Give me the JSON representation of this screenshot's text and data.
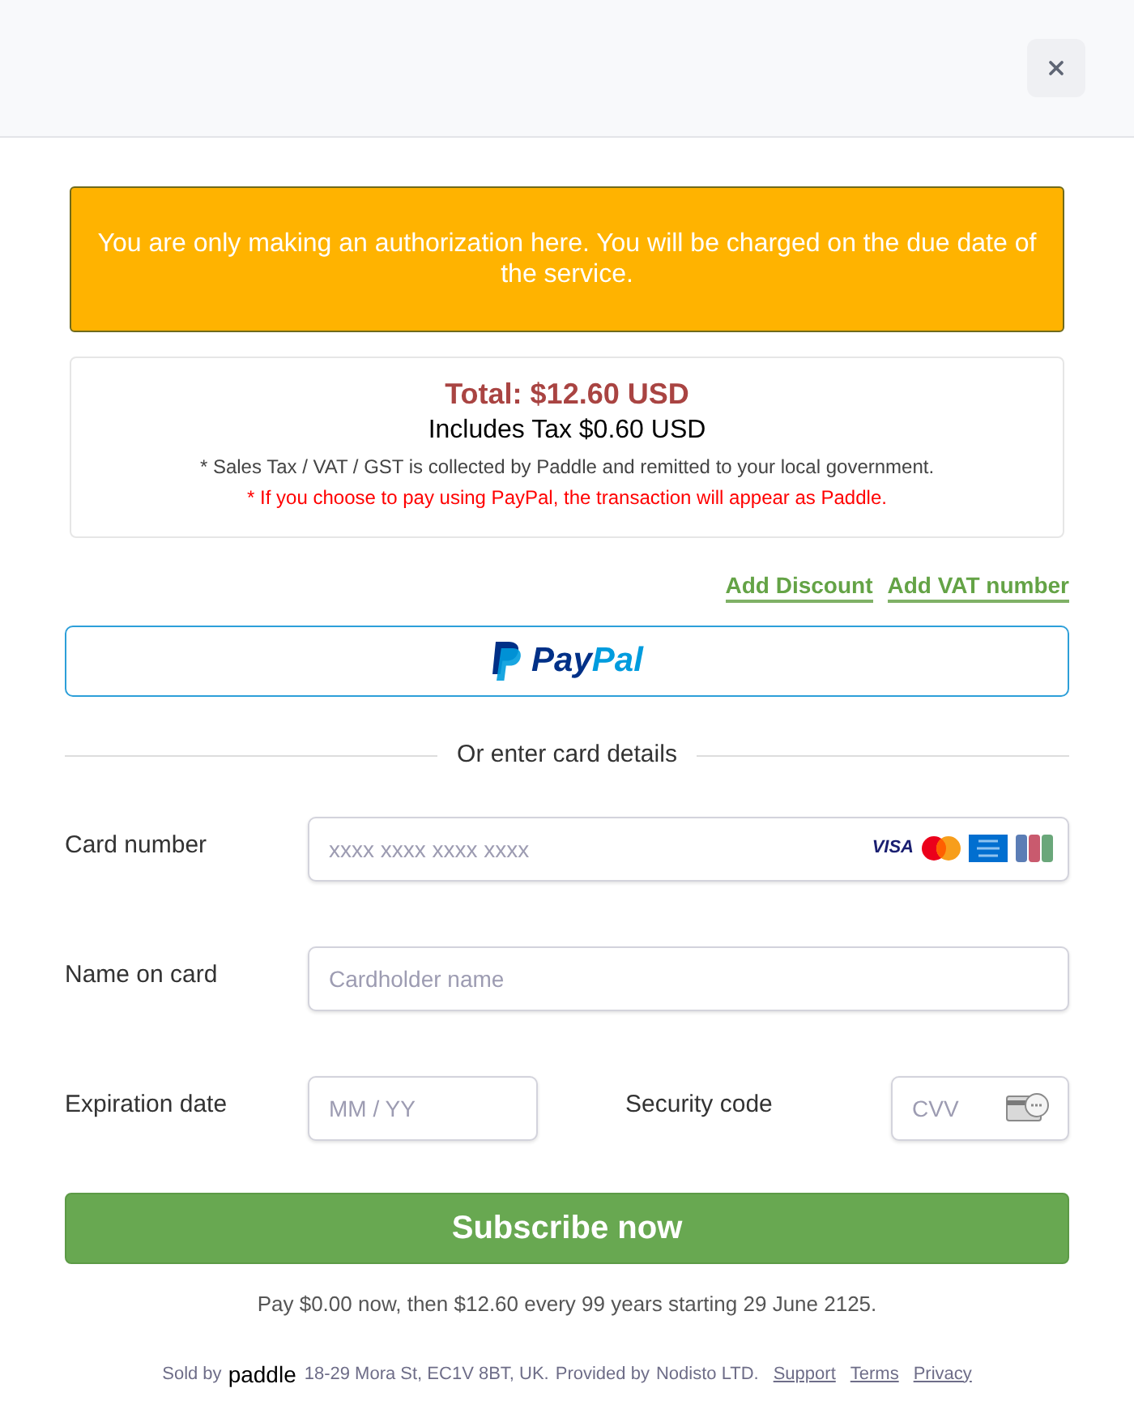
{
  "notice": "You are only making an authorization here. You will be charged on the due date of the service.",
  "summary": {
    "total": "Total: $12.60 USD",
    "tax": "Includes Tax $0.60 USD",
    "tax_note": "* Sales Tax / VAT / GST is collected by Paddle and remitted to your local government.",
    "paypal_note": "* If you choose to pay using PayPal, the transaction will appear as Paddle."
  },
  "links": [
    "Add Discount",
    "Add VAT number"
  ],
  "paypal_button": {
    "logo_text": [
      "Pay",
      "Pal"
    ]
  },
  "divider": "Or enter card details",
  "card_number": {
    "label": "Card number",
    "placeholder": "xxxx xxxx xxxx xxxx",
    "brand_text": "VISA"
  },
  "name_on_card": {
    "label": "Name on card",
    "placeholder": "Cardholder name"
  },
  "expiration": {
    "label": "Expiration date",
    "placeholder": "MM / YY"
  },
  "security_code": {
    "label": "Security code",
    "placeholder": "CVV"
  },
  "subscribe_button": "Subscribe now",
  "payment_terms": "Pay $0.00 now, then $12.60 every 99 years starting 29 June 2125.",
  "footer": {
    "sold_by": "Sold by",
    "brand": "paddle",
    "address": "18-29 Mora St, EC1V 8BT, UK.",
    "provided_by": "Provided by",
    "company": "Nodisto LTD.",
    "links": [
      "Support",
      "Terms",
      "Privacy"
    ]
  }
}
